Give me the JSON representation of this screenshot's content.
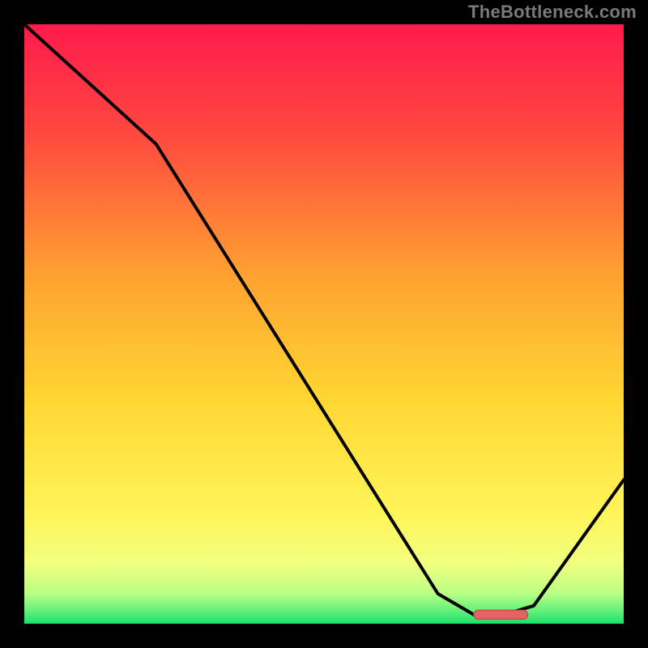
{
  "attribution": "TheBottleneck.com",
  "colors": {
    "background": "#000000",
    "gradient_top": "#ff1a4b",
    "gradient_upper_mid": "#ffa231",
    "gradient_mid": "#ffd531",
    "gradient_lower_mid": "#f5ff6e",
    "gradient_bottom": "#19e06b",
    "curve": "#000000",
    "marker_fill": "#e06666",
    "marker_stroke": "#d24a4a"
  },
  "chart_data": {
    "type": "line",
    "title": "",
    "xlabel": "",
    "ylabel": "",
    "xlim": [
      0,
      100
    ],
    "ylim": [
      0,
      100
    ],
    "series": [
      {
        "name": "bottleneck-curve",
        "x": [
          0,
          22,
          69,
          75,
          80,
          85,
          100
        ],
        "values": [
          100,
          80,
          5.0,
          1.5,
          1.5,
          3,
          24
        ]
      }
    ],
    "marker": {
      "x_range": [
        75,
        84
      ],
      "y": 1.5
    }
  }
}
